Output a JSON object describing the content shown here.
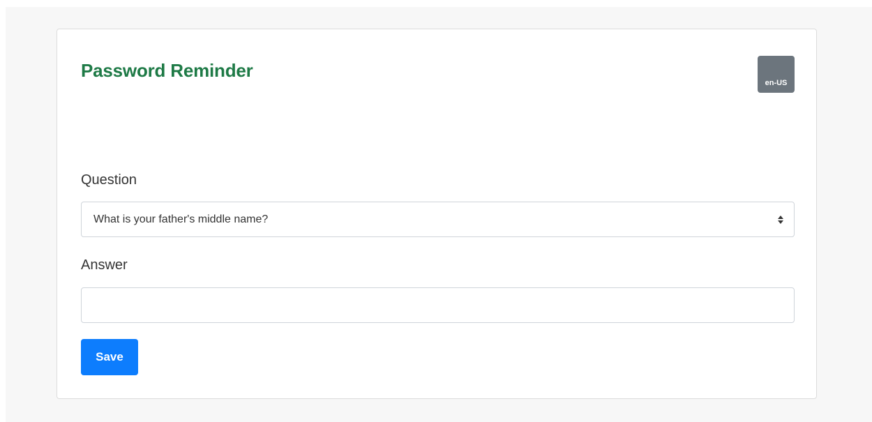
{
  "form": {
    "title": "Password Reminder",
    "locale_badge": "en-US",
    "question_label": "Question",
    "question_selected": "What is your father's middle name?",
    "answer_label": "Answer",
    "answer_value": "",
    "save_label": "Save"
  },
  "icons": {
    "select_arrows": "sort-arrows-icon"
  },
  "colors": {
    "title": "#1e7a46",
    "badge_bg": "#6c757d",
    "save_button_bg": "#0d7dfd"
  }
}
